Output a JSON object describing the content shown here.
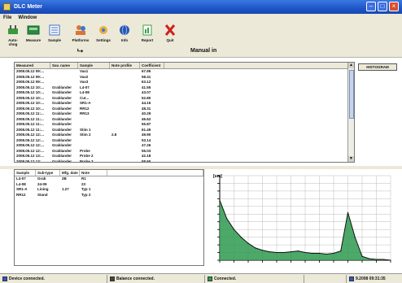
{
  "window": {
    "title": "DLC Meter"
  },
  "menubar": {
    "items": [
      "File",
      "Window"
    ]
  },
  "toolbar": {
    "buttons": [
      {
        "label": "Auto-chng",
        "icon": "ac-plug-icon",
        "color": "#3a9a3a"
      },
      {
        "label": "Measure",
        "icon": "measure-icon",
        "color": "#2c8a40"
      },
      {
        "label": "Sample",
        "icon": "sample-list-icon",
        "color": "#3d6ec9"
      },
      {
        "label": "Platforms",
        "icon": "people-icon",
        "color": "#d9743a"
      },
      {
        "label": "Settings",
        "icon": "settings-icon",
        "color": "#3a78d0"
      },
      {
        "label": "Info",
        "icon": "info-globe-icon",
        "color": "#2a58b0"
      },
      {
        "label": "Report",
        "icon": "report-icon",
        "color": "#3aa048"
      },
      {
        "label": "Quit",
        "icon": "quit-x-icon",
        "color": "#d02020"
      }
    ],
    "mode_label": "Manual in"
  },
  "history_button": "HISTOGRAM",
  "table": {
    "columns": [
      "Measured",
      "Sav. name",
      "Sample",
      "Note profile",
      "Coefficient"
    ],
    "rows": [
      [
        "2008.05.12 09:...",
        "",
        "Vax1",
        "",
        "67.95"
      ],
      [
        "2008.05.12 09:...",
        "",
        "Vax2",
        "",
        "58.41"
      ],
      [
        "2008.05.12 09:...",
        "",
        "Vax3",
        "",
        "63.12"
      ],
      [
        "2008.05.12 10:...",
        "Grablander",
        "L4-07",
        "",
        "41.55"
      ],
      [
        "2008.05.12 10:...",
        "Grablander",
        "L4-08",
        "",
        "43.07"
      ],
      [
        "2008.05.12 10:...",
        "Grablander",
        "Cut...",
        "",
        "52.80"
      ],
      [
        "2008.05.12 10:...",
        "Grablander",
        "SR1-A",
        "",
        "44.16"
      ],
      [
        "2008.05.12 10:...",
        "Grablander",
        "RR12",
        "",
        "48.31"
      ],
      [
        "2008.05.12 11:...",
        "Grablander",
        "RR13",
        "",
        "40.29"
      ],
      [
        "2008.05.12 11:...",
        "Grablander",
        "",
        "",
        "46.62"
      ],
      [
        "2008.05.12 11:...",
        "Grablander",
        "",
        "",
        "55.87"
      ],
      [
        "2008.05.12 11:...",
        "Grablander",
        "Stim 1",
        "",
        "61.45"
      ],
      [
        "2008.05.12 12:...",
        "Grablander",
        "Stim 2",
        "2.8",
        "49.90"
      ],
      [
        "2008.05.12 12:...",
        "Grablander",
        "",
        "",
        "53.14"
      ],
      [
        "2008.05.12 12:...",
        "Grablander",
        "",
        "",
        "47.26"
      ],
      [
        "2008.05.12 12:...",
        "Grablander",
        "Probe",
        "",
        "55.03"
      ],
      [
        "2008.05.12 13:...",
        "Grablander",
        "Probe 2",
        "",
        "42.18"
      ],
      [
        "2008.05.12 13:...",
        "Grablander",
        "Probe 3",
        "",
        "58.60"
      ]
    ]
  },
  "lower_table": {
    "columns": [
      "Sample",
      "Sub-type",
      "Mfg. date",
      "Note"
    ],
    "rows": [
      [
        "L4-07",
        "Grab",
        "2B",
        "R1"
      ],
      [
        "L4-08",
        "24-09",
        "",
        "23"
      ],
      [
        "SR1-A",
        "Lining",
        "1.27",
        "Typ 1"
      ],
      [
        "RR12",
        "Stand",
        "",
        "Typ 2"
      ]
    ]
  },
  "chart_data": {
    "type": "area",
    "title": "",
    "xlabel": "",
    "ylabel": "[um]",
    "x": [
      0,
      10,
      20,
      30,
      40,
      50,
      60,
      70,
      80,
      90,
      100,
      110,
      120,
      130,
      140,
      150,
      160,
      170,
      180,
      190,
      200,
      210,
      220,
      230,
      240
    ],
    "values": [
      78,
      54,
      40,
      30,
      22,
      16,
      13,
      11,
      10,
      10,
      11,
      12,
      10,
      9,
      9,
      8,
      9,
      12,
      62,
      30,
      5,
      2,
      1,
      1,
      0
    ],
    "xlim": [
      0,
      240
    ],
    "ylim": [
      0,
      110
    ],
    "grid": true,
    "fill_color": "#2e9a50",
    "line_color": "#111111"
  },
  "status": [
    {
      "text": "Device connected.",
      "color": "#2a58d0"
    },
    {
      "text": "Balance connected.",
      "color": "#444444"
    },
    {
      "text": "Connected.",
      "color": "#2e9a50"
    },
    {
      "text": "",
      "color": "#ece9d8"
    },
    {
      "text": "9.2008 09:31:35",
      "color": "#2a58d0"
    }
  ]
}
